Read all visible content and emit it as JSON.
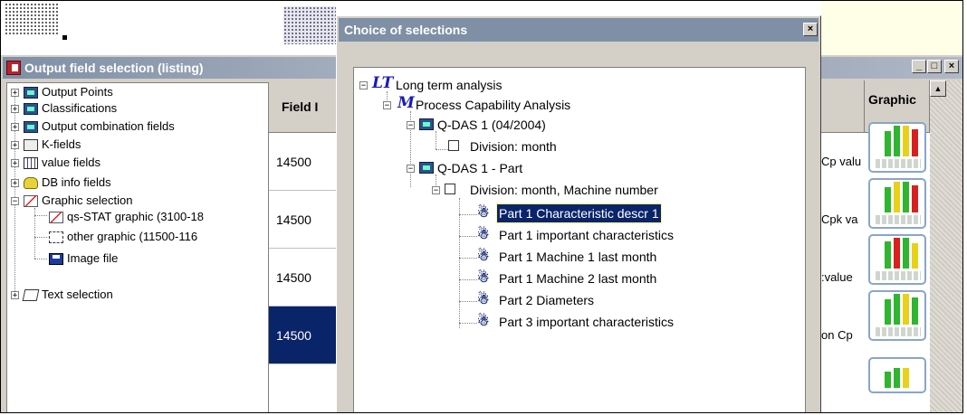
{
  "left_panel": {
    "title": "Output field selection (listing)",
    "tree": [
      {
        "label": "Output Points",
        "icon": "table-icon",
        "expander": "+"
      },
      {
        "label": "Classifications",
        "icon": "table-icon",
        "expander": "+"
      },
      {
        "label": "Output combination fields",
        "icon": "table-icon",
        "expander": "+"
      },
      {
        "label": "K-fields",
        "icon": "k-field-icon",
        "expander": "+"
      },
      {
        "label": "value fields",
        "icon": "value-fields-icon",
        "expander": "+"
      },
      {
        "label": "DB info fields",
        "icon": "database-icon",
        "expander": "+"
      },
      {
        "label": "Graphic selection",
        "icon": "graphic-icon",
        "expander": "−"
      },
      {
        "label": "qs-STAT graphic (3100-18",
        "icon": "graphic-icon"
      },
      {
        "label": "other graphic (11500-116",
        "icon": "other-graphic-icon"
      },
      {
        "label": "Image file",
        "icon": "disk-icon"
      },
      {
        "label": "Text selection",
        "icon": "text-icon",
        "expander": "+"
      }
    ]
  },
  "table": {
    "field_header": "Field I",
    "graphic_header": "Graphic",
    "rows": [
      {
        "field": "14500",
        "name": "Cp valu",
        "selected": false
      },
      {
        "field": "14500",
        "name": "Cpk va",
        "selected": false
      },
      {
        "field": "14500",
        "name": "value:",
        "selected": false
      },
      {
        "field": "14500",
        "name": "on Cp",
        "selected": true
      }
    ]
  },
  "window_buttons": {
    "minimize": "_",
    "maximize": "□",
    "close": "×"
  },
  "dialog": {
    "title": "Choice of selections",
    "close": "×",
    "tree": [
      {
        "label": "Long term analysis",
        "glyph": "LT",
        "expander": "−"
      },
      {
        "label": "Process Capability Analysis",
        "glyph": "M",
        "expander": "−"
      },
      {
        "label": "Q-DAS 1 (04/2004)",
        "expander": "−"
      },
      {
        "label": "Division: month"
      },
      {
        "label": "Q-DAS 1 - Part",
        "expander": "−"
      },
      {
        "label": "Division: month, Machine number",
        "expander": "−"
      },
      {
        "label": "Part 1 Characteristic descr 1",
        "selected": true
      },
      {
        "label": "Part 1 important characteristics"
      },
      {
        "label": "Part 1 Machine 1 last month"
      },
      {
        "label": "Part 1 Machine 2 last month"
      },
      {
        "label": "Part 2 Diameters"
      },
      {
        "label": "Part 3 important characteristics"
      }
    ]
  },
  "colors": {
    "selection": "#0a246a",
    "title_bar": "#7f8fa6",
    "face": "#d4d0c8"
  }
}
